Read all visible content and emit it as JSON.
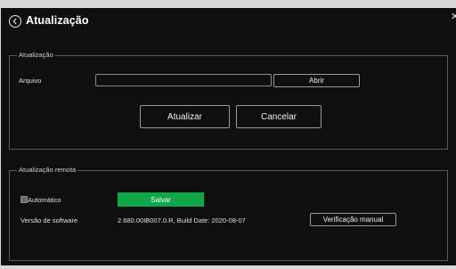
{
  "dialog": {
    "title": "Atualização",
    "close_icon": "close-icon",
    "back_icon": "back-circle-icon"
  },
  "update_section": {
    "legend": "Atualização",
    "file_label": "Arquivo",
    "file_value": "",
    "open_button": "Abrir",
    "update_button": "Atualizar",
    "cancel_button": "Cancelar"
  },
  "remote_section": {
    "legend": "Atualização remota",
    "auto_label": "Automático",
    "auto_checked": false,
    "save_button": "Salvar",
    "version_label": "Versão de software",
    "version_value": "2.680.00IB007.0.R, Build Date: 2020-08-07",
    "manual_check_button": "Verificação manual"
  },
  "colors": {
    "background": "#0f0f0f",
    "page": "#d9d9d9",
    "accent_green": "#12a64a",
    "border": "#5a5a5a"
  }
}
